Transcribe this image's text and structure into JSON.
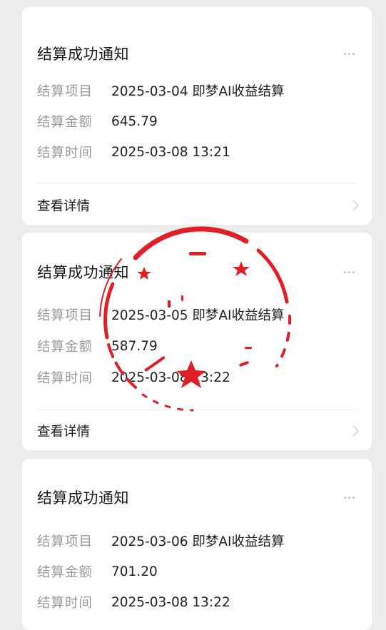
{
  "cards": [
    {
      "title": "结算成功通知",
      "rows": [
        {
          "label": "结算项目",
          "value": "2025-03-04 即梦AI收益结算"
        },
        {
          "label": "结算金额",
          "value": "645.79"
        },
        {
          "label": "结算时间",
          "value": "2025-03-08 13:21"
        }
      ],
      "detail_label": "查看详情"
    },
    {
      "title": "结算成功通知",
      "rows": [
        {
          "label": "结算项目",
          "value": "2025-03-05 即梦AI收益结算"
        },
        {
          "label": "结算金额",
          "value": "587.79"
        },
        {
          "label": "结算时间",
          "value": "2025-03-08 13:22"
        }
      ],
      "detail_label": "查看详情"
    },
    {
      "title": "结算成功通知",
      "rows": [
        {
          "label": "结算项目",
          "value": "2025-03-06 即梦AI收益结算"
        },
        {
          "label": "结算金额",
          "value": "701.20"
        },
        {
          "label": "结算时间",
          "value": "2025-03-08 13:22"
        }
      ]
    }
  ],
  "icons": {
    "more": "more-dots-icon",
    "chevron": "chevron-right-icon"
  },
  "colors": {
    "background": "#ececec",
    "card": "#ffffff",
    "label": "#999999",
    "value": "#222222",
    "stamp": "#e01e26"
  }
}
